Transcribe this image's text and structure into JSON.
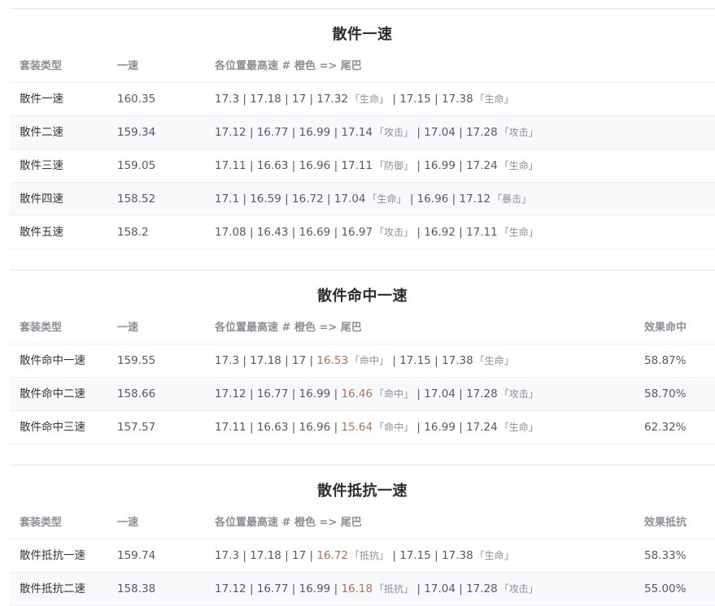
{
  "sections": [
    {
      "title": "散件一速",
      "headers": {
        "type": "套装类型",
        "speed": "一速",
        "detail": "各位置最高速 # 橙色 => 尾巴",
        "extra": ""
      },
      "rows": [
        {
          "type": "散件一速",
          "speed": "160.35",
          "extra": "",
          "parts": [
            {
              "v": "17.3",
              "hl": false,
              "tag": ""
            },
            {
              "v": "17.18",
              "hl": false,
              "tag": ""
            },
            {
              "v": "17",
              "hl": false,
              "tag": ""
            },
            {
              "v": "17.32",
              "hl": false,
              "tag": "「生命」"
            },
            {
              "v": "17.15",
              "hl": false,
              "tag": ""
            },
            {
              "v": "17.38",
              "hl": false,
              "tag": "「生命」"
            }
          ]
        },
        {
          "type": "散件二速",
          "speed": "159.34",
          "extra": "",
          "parts": [
            {
              "v": "17.12",
              "hl": false,
              "tag": ""
            },
            {
              "v": "16.77",
              "hl": false,
              "tag": ""
            },
            {
              "v": "16.99",
              "hl": false,
              "tag": ""
            },
            {
              "v": "17.14",
              "hl": false,
              "tag": "「攻击」"
            },
            {
              "v": "17.04",
              "hl": false,
              "tag": ""
            },
            {
              "v": "17.28",
              "hl": false,
              "tag": "「攻击」"
            }
          ]
        },
        {
          "type": "散件三速",
          "speed": "159.05",
          "extra": "",
          "parts": [
            {
              "v": "17.11",
              "hl": false,
              "tag": ""
            },
            {
              "v": "16.63",
              "hl": false,
              "tag": ""
            },
            {
              "v": "16.96",
              "hl": false,
              "tag": ""
            },
            {
              "v": "17.11",
              "hl": false,
              "tag": "「防御」"
            },
            {
              "v": "16.99",
              "hl": false,
              "tag": ""
            },
            {
              "v": "17.24",
              "hl": false,
              "tag": "「生命」"
            }
          ]
        },
        {
          "type": "散件四速",
          "speed": "158.52",
          "extra": "",
          "parts": [
            {
              "v": "17.1",
              "hl": false,
              "tag": ""
            },
            {
              "v": "16.59",
              "hl": false,
              "tag": ""
            },
            {
              "v": "16.72",
              "hl": false,
              "tag": ""
            },
            {
              "v": "17.04",
              "hl": false,
              "tag": "「生命」"
            },
            {
              "v": "16.96",
              "hl": false,
              "tag": ""
            },
            {
              "v": "17.12",
              "hl": false,
              "tag": "「暴击」"
            }
          ]
        },
        {
          "type": "散件五速",
          "speed": "158.2",
          "extra": "",
          "parts": [
            {
              "v": "17.08",
              "hl": false,
              "tag": ""
            },
            {
              "v": "16.43",
              "hl": false,
              "tag": ""
            },
            {
              "v": "16.69",
              "hl": false,
              "tag": ""
            },
            {
              "v": "16.97",
              "hl": false,
              "tag": "「攻击」"
            },
            {
              "v": "16.92",
              "hl": false,
              "tag": ""
            },
            {
              "v": "17.11",
              "hl": false,
              "tag": "「生命」"
            }
          ]
        }
      ]
    },
    {
      "title": "散件命中一速",
      "headers": {
        "type": "套装类型",
        "speed": "一速",
        "detail": "各位置最高速 # 橙色 => 尾巴",
        "extra": "效果命中"
      },
      "rows": [
        {
          "type": "散件命中一速",
          "speed": "159.55",
          "extra": "58.87%",
          "parts": [
            {
              "v": "17.3",
              "hl": false,
              "tag": ""
            },
            {
              "v": "17.18",
              "hl": false,
              "tag": ""
            },
            {
              "v": "17",
              "hl": false,
              "tag": ""
            },
            {
              "v": "16.53",
              "hl": true,
              "tag": "「命中」"
            },
            {
              "v": "17.15",
              "hl": false,
              "tag": ""
            },
            {
              "v": "17.38",
              "hl": false,
              "tag": "「生命」"
            }
          ]
        },
        {
          "type": "散件命中二速",
          "speed": "158.66",
          "extra": "58.70%",
          "parts": [
            {
              "v": "17.12",
              "hl": false,
              "tag": ""
            },
            {
              "v": "16.77",
              "hl": false,
              "tag": ""
            },
            {
              "v": "16.99",
              "hl": false,
              "tag": ""
            },
            {
              "v": "16.46",
              "hl": true,
              "tag": "「命中」"
            },
            {
              "v": "17.04",
              "hl": false,
              "tag": ""
            },
            {
              "v": "17.28",
              "hl": false,
              "tag": "「攻击」"
            }
          ]
        },
        {
          "type": "散件命中三速",
          "speed": "157.57",
          "extra": "62.32%",
          "parts": [
            {
              "v": "17.11",
              "hl": false,
              "tag": ""
            },
            {
              "v": "16.63",
              "hl": false,
              "tag": ""
            },
            {
              "v": "16.96",
              "hl": false,
              "tag": ""
            },
            {
              "v": "15.64",
              "hl": true,
              "tag": "「命中」"
            },
            {
              "v": "16.99",
              "hl": false,
              "tag": ""
            },
            {
              "v": "17.24",
              "hl": false,
              "tag": "「生命」"
            }
          ]
        }
      ]
    },
    {
      "title": "散件抵抗一速",
      "headers": {
        "type": "套装类型",
        "speed": "一速",
        "detail": "各位置最高速 # 橙色 => 尾巴",
        "extra": "效果抵抗"
      },
      "rows": [
        {
          "type": "散件抵抗一速",
          "speed": "159.74",
          "extra": "58.33%",
          "parts": [
            {
              "v": "17.3",
              "hl": false,
              "tag": ""
            },
            {
              "v": "17.18",
              "hl": false,
              "tag": ""
            },
            {
              "v": "17",
              "hl": false,
              "tag": ""
            },
            {
              "v": "16.72",
              "hl": true,
              "tag": "「抵抗」"
            },
            {
              "v": "17.15",
              "hl": false,
              "tag": ""
            },
            {
              "v": "17.38",
              "hl": false,
              "tag": "「生命」"
            }
          ]
        },
        {
          "type": "散件抵抗二速",
          "speed": "158.38",
          "extra": "55.00%",
          "parts": [
            {
              "v": "17.12",
              "hl": false,
              "tag": ""
            },
            {
              "v": "16.77",
              "hl": false,
              "tag": ""
            },
            {
              "v": "16.99",
              "hl": false,
              "tag": ""
            },
            {
              "v": "16.18",
              "hl": true,
              "tag": "「抵抗」"
            },
            {
              "v": "17.04",
              "hl": false,
              "tag": ""
            },
            {
              "v": "17.28",
              "hl": false,
              "tag": "「攻击」"
            }
          ]
        }
      ]
    }
  ],
  "separator": "|",
  "colors": {
    "highlight": "#b0705a",
    "text": "#555a61",
    "header": "#8c8f96",
    "tag": "#8a8f97"
  }
}
